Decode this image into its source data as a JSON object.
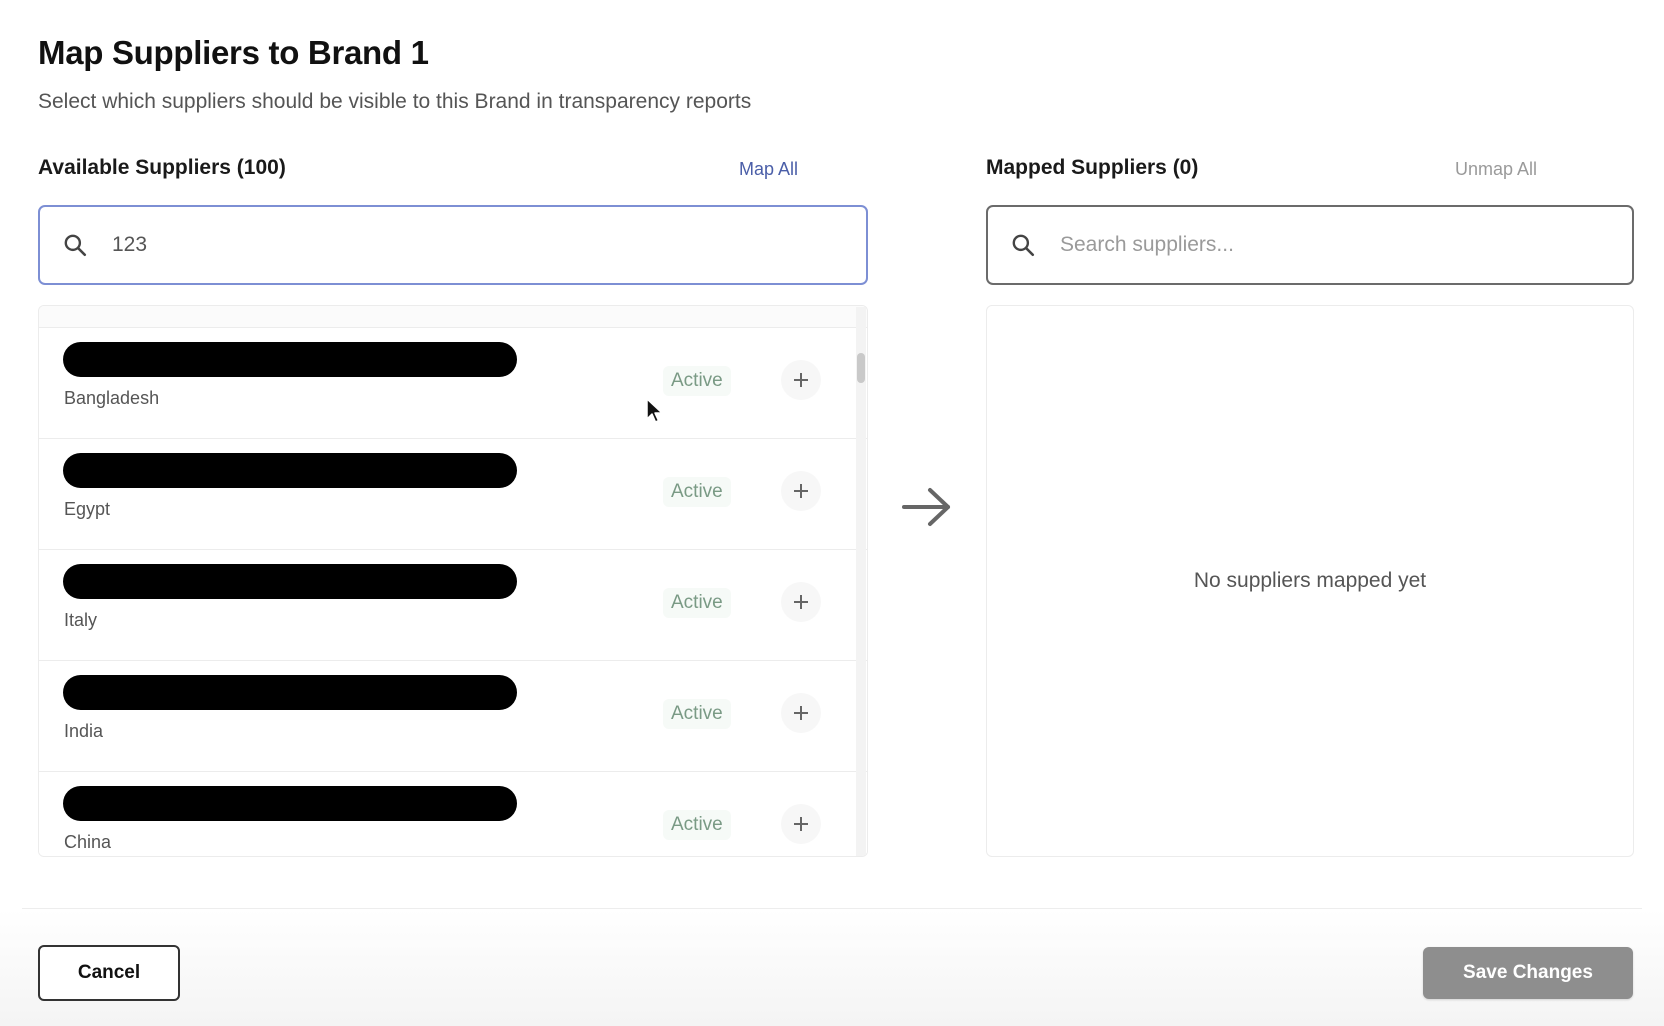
{
  "header": {
    "title": "Map Suppliers to Brand 1",
    "subtitle": "Select which suppliers should be visible to this Brand in transparency reports"
  },
  "available": {
    "heading": "Available Suppliers (100)",
    "map_all_label": "Map All",
    "search_value": "123",
    "search_placeholder": "",
    "items": [
      {
        "country": "Bangladesh",
        "status": "Active"
      },
      {
        "country": "Egypt",
        "status": "Active"
      },
      {
        "country": "Italy",
        "status": "Active"
      },
      {
        "country": "India",
        "status": "Active"
      },
      {
        "country": "China",
        "status": "Active"
      }
    ]
  },
  "mapped": {
    "heading": "Mapped Suppliers (0)",
    "unmap_all_label": "Unmap All",
    "search_value": "",
    "search_placeholder": "Search suppliers...",
    "empty_text": "No suppliers mapped yet"
  },
  "footer": {
    "cancel_label": "Cancel",
    "save_label": "Save Changes"
  },
  "icons": {
    "search": "search-icon",
    "add": "plus-icon",
    "transfer": "arrow-right-icon"
  },
  "colors": {
    "accent_link": "#4a5ea8",
    "status_green": "#7a9a85",
    "save_disabled": "#8e8e8e"
  }
}
